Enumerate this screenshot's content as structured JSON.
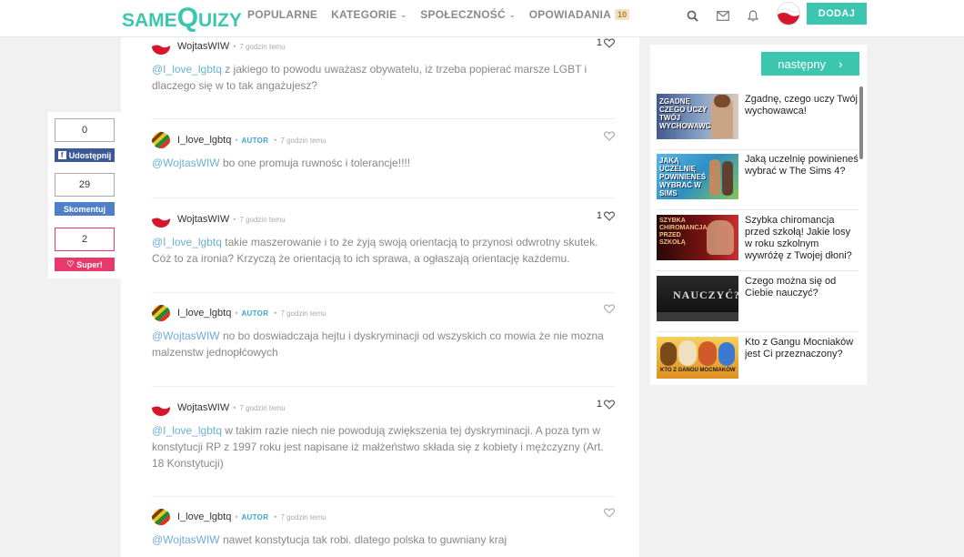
{
  "header": {
    "logo_part1": "SAME",
    "logo_part2": "Q",
    "logo_part3": "UIZY",
    "nav": [
      {
        "label": "POPULARNE"
      },
      {
        "label": "KATEGORIE"
      },
      {
        "label": "SPOŁECZNOŚĆ"
      },
      {
        "label": "OPOWIADANIA",
        "badge": "10"
      }
    ],
    "add_button": "DODAJ",
    "accent_color": "#3cc6b0"
  },
  "share": {
    "facebook_count": "0",
    "facebook_label": "Udostępnij",
    "comments_count": "29",
    "comments_label": "Skomentuj",
    "super_count": "2",
    "super_label": "Super!"
  },
  "comments": [
    {
      "author": "WojtasWIW",
      "role": "",
      "time": "7 godzin temu",
      "likes": "1",
      "mention": "@I_love_lgbtq",
      "text": " z jakiego to powodu uważasz obywatelu, iż trzeba popierać marsze LGBT i dlaczego się w to tak angażujesz?"
    },
    {
      "author": "I_love_lgbtq",
      "role": "AUTOR",
      "time": "7 godzin temu",
      "likes": "",
      "mention": "@WojtasWIW",
      "text": " bo one promuja ruwnośc i tolerancje!!!!"
    },
    {
      "author": "WojtasWIW",
      "role": "",
      "time": "7 godzin temu",
      "likes": "1",
      "mention": "@I_love_lgbtq",
      "text": " takie maszerowanie i to że żyją swoją orientacją to przynosi odwrotny skutek. Cóż to za ironia? Krzyczą że orientacją to ich sprawa, a ogłaszają orientację każdemu."
    },
    {
      "author": "I_love_lgbtq",
      "role": "AUTOR",
      "time": "7 godzin temu",
      "likes": "",
      "mention": "@WojtasWIW",
      "text": " no bo doswiadczaja hejtu i dyskryminacji od wszyskich co mowia że nie mozna malzenstw jednopłćowych"
    },
    {
      "author": "WojtasWIW",
      "role": "",
      "time": "7 godzin temu",
      "likes": "1",
      "mention": "@I_love_lgbtq",
      "text": " w takim razie niech nie powodują zwiększenia tej dyskryminacji. A poza tym w konstytucji RP z 1997 roku jest napisane iż małżeństwo składa się z kobiety i mężczyzny (Art. 18 Konstytucji)"
    },
    {
      "author": "I_love_lgbtq",
      "role": "AUTOR",
      "time": "7 godzin temu",
      "likes": "",
      "mention": "@WojtasWIW",
      "text": " nawet konstytucja tak robi. dlatego polska to guwniany kraj"
    }
  ],
  "sidebar": {
    "next_label": "następny",
    "items": [
      {
        "title": "Zgadnę, czego uczy Twój wychowawca!",
        "thumb_text": "ZGADNĘ CZEGO UCZY TWÓJ WYCHOWAWCA",
        "thumb_color": "#5a6fa0"
      },
      {
        "title": "Jaką uczelnię powinieneś wybrać w The Sims 4?",
        "thumb_text": "JAKĄ UCZELNIĘ POWINIENEŚ WYBRAĆ W SIMS",
        "thumb_color": "#3aa0d0"
      },
      {
        "title": "Szybka chiromancja przed szkołą! Jakie losy w roku szkolnym wywróżę z Twojej dłoni?",
        "thumb_text": "SZYBKA CHIROMANCJA PRZED SZKOŁĄ",
        "thumb_color": "#6a1010"
      },
      {
        "title": "Czego można się od Ciebie nauczyć?",
        "thumb_text": "NAUCZYĆ?",
        "thumb_color": "#1a1a1a"
      },
      {
        "title": "Kto z Gangu Mocniaków jest Ci przeznaczony?",
        "thumb_text": "KTO Z GANGU MOCNIAKÓW",
        "thumb_color": "#e0a020"
      }
    ]
  }
}
